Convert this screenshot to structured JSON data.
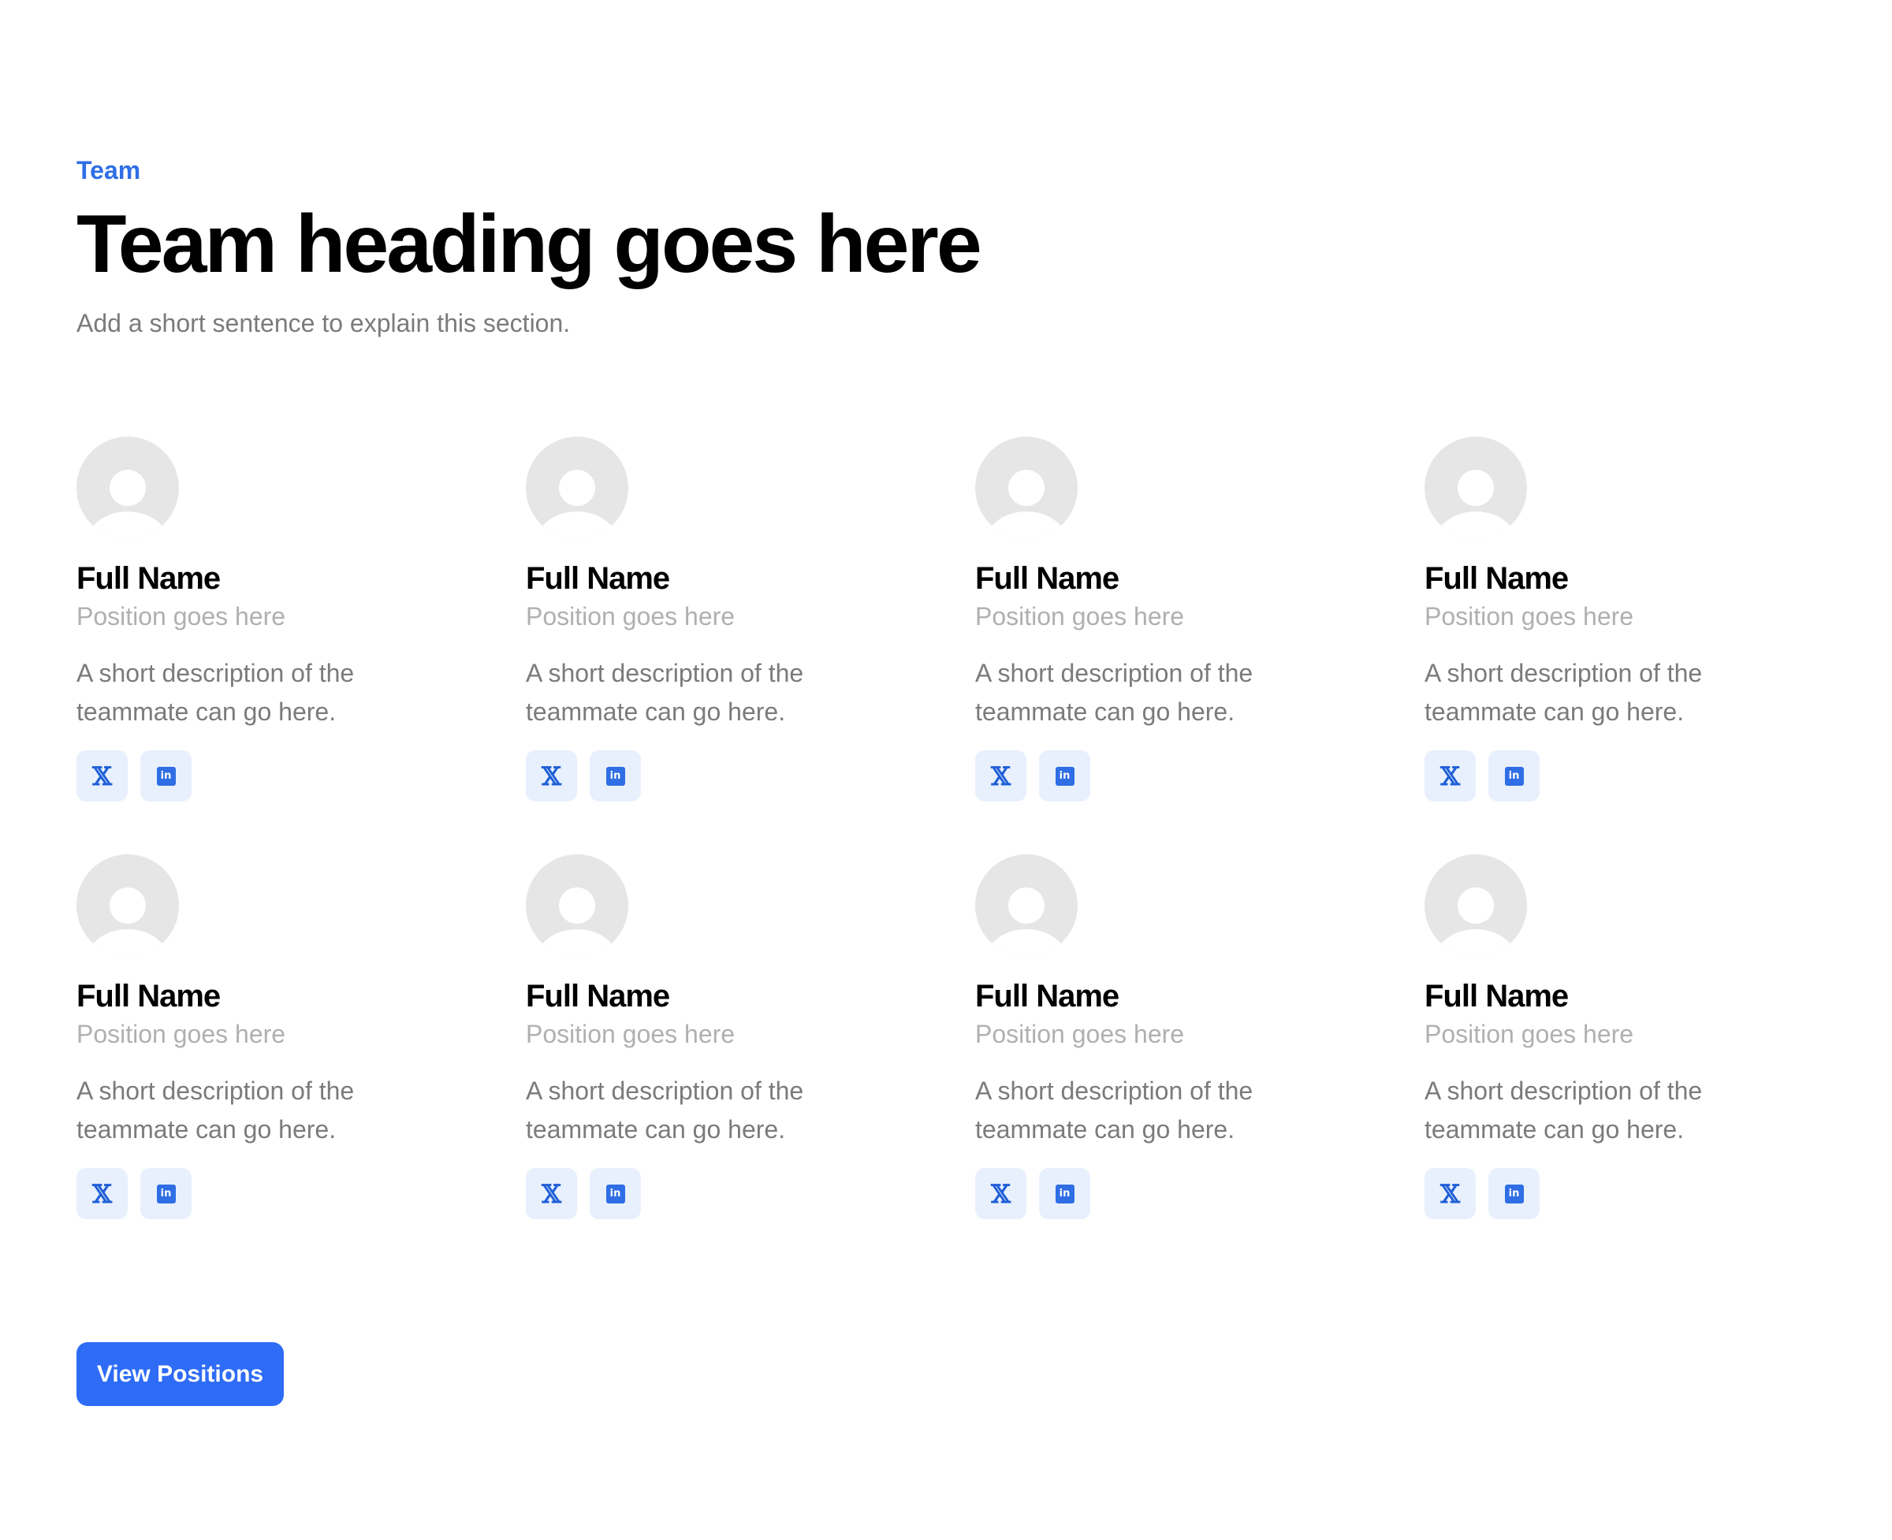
{
  "section": {
    "eyebrow": "Team",
    "heading": "Team heading goes here",
    "subtitle": "Add a short sentence to explain this section."
  },
  "members": [
    {
      "name": "Full Name",
      "position": "Position goes here",
      "description": "A short description of the teammate can go here."
    },
    {
      "name": "Full Name",
      "position": "Position goes here",
      "description": "A short description of the teammate can go here."
    },
    {
      "name": "Full Name",
      "position": "Position goes here",
      "description": "A short description of the teammate can go here."
    },
    {
      "name": "Full Name",
      "position": "Position goes here",
      "description": "A short description of the teammate can go here."
    },
    {
      "name": "Full Name",
      "position": "Position goes here",
      "description": "A short description of the teammate can go here."
    },
    {
      "name": "Full Name",
      "position": "Position goes here",
      "description": "A short description of the teammate can go here."
    },
    {
      "name": "Full Name",
      "position": "Position goes here",
      "description": "A short description of the teammate can go here."
    },
    {
      "name": "Full Name",
      "position": "Position goes here",
      "description": "A short description of the teammate can go here."
    }
  ],
  "social_icons": {
    "x": {
      "icon": "x-icon",
      "glyph": "𝕏"
    },
    "linkedin": {
      "icon": "linkedin-icon",
      "glyph": "in"
    }
  },
  "cta": {
    "label": "View Positions"
  },
  "colors": {
    "accent": "#2f6ee5",
    "button": "#2e6cf6",
    "heading": "#000000",
    "muted": "#7b7b7b",
    "position": "#b0b0b0",
    "avatar": "#e6e6e6",
    "social_bg": "#e8f0fd"
  }
}
